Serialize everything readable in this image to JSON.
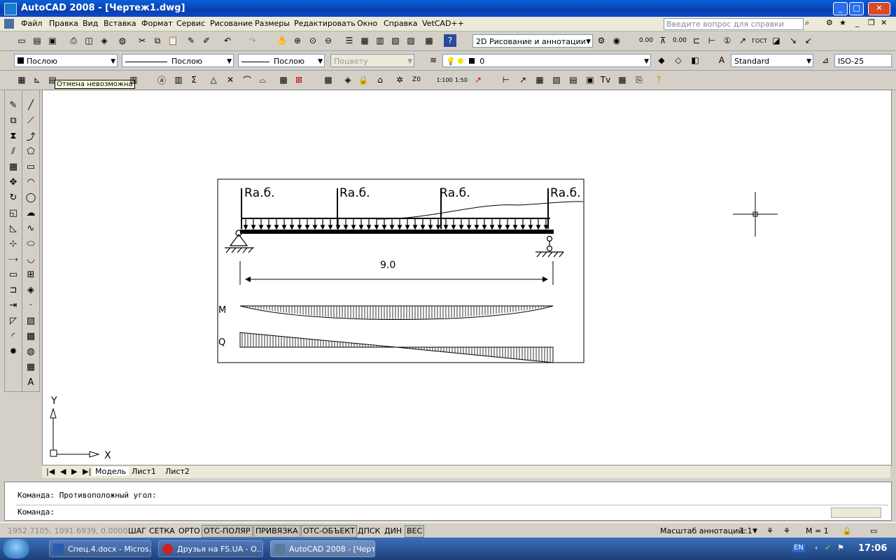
{
  "window": {
    "title": "AutoCAD 2008 - [Чертеж1.dwg]"
  },
  "menu": {
    "items": [
      "Файл",
      "Правка",
      "Вид",
      "Вставка",
      "Формат",
      "Сервис",
      "Рисование",
      "Размеры",
      "Редактировать",
      "Окно",
      "Справка",
      "VetCAD++"
    ],
    "help_placeholder": "Введите вопрос для справки"
  },
  "toolbar": {
    "workspace": "2D Рисование и аннотации",
    "color": "Послою",
    "linetype": "Послою",
    "lineweight": "Послою",
    "plotstyle": "Поцвету",
    "layer": "0",
    "textstyle": "Standard",
    "dimstyle": "ISO-25",
    "tooltip": "Отмена невозможна"
  },
  "drawing": {
    "reaction_label": "Rа.б.",
    "span": "9.0",
    "moment_label": "M",
    "shear_label": "Q",
    "ucs_x": "X",
    "ucs_y": "Y"
  },
  "tabs": [
    "Модель",
    "Лист1",
    "Лист2"
  ],
  "command": {
    "history": "Команда: Противоположный угол:",
    "prompt": "Команда:"
  },
  "status": {
    "coords": "1952.7105, 1091.6939, 0.0000",
    "toggles": [
      "ШАГ",
      "СЕТКА",
      "ОРТО",
      "ОТС-ПОЛЯР",
      "ПРИВЯЗКА",
      "ОТС-ОБЪЕКТ",
      "ДПСК",
      "ДИН",
      "ВЕС"
    ],
    "annotation_scale_label": "Масштаб аннотаций:",
    "annotation_scale": "1:1",
    "m_value": "M = 1"
  },
  "taskbar": {
    "tasks": [
      "Спец.4.docx - Micros...",
      "Друзья на FS.UA - О...",
      "AutoCAD 2008 - [Черт..."
    ],
    "lang": "EN",
    "clock": "17:06"
  },
  "colors": {
    "title_bar": "#0a3fb0",
    "canvas": "#ffffff",
    "toolbar": "#d4d0c8"
  }
}
